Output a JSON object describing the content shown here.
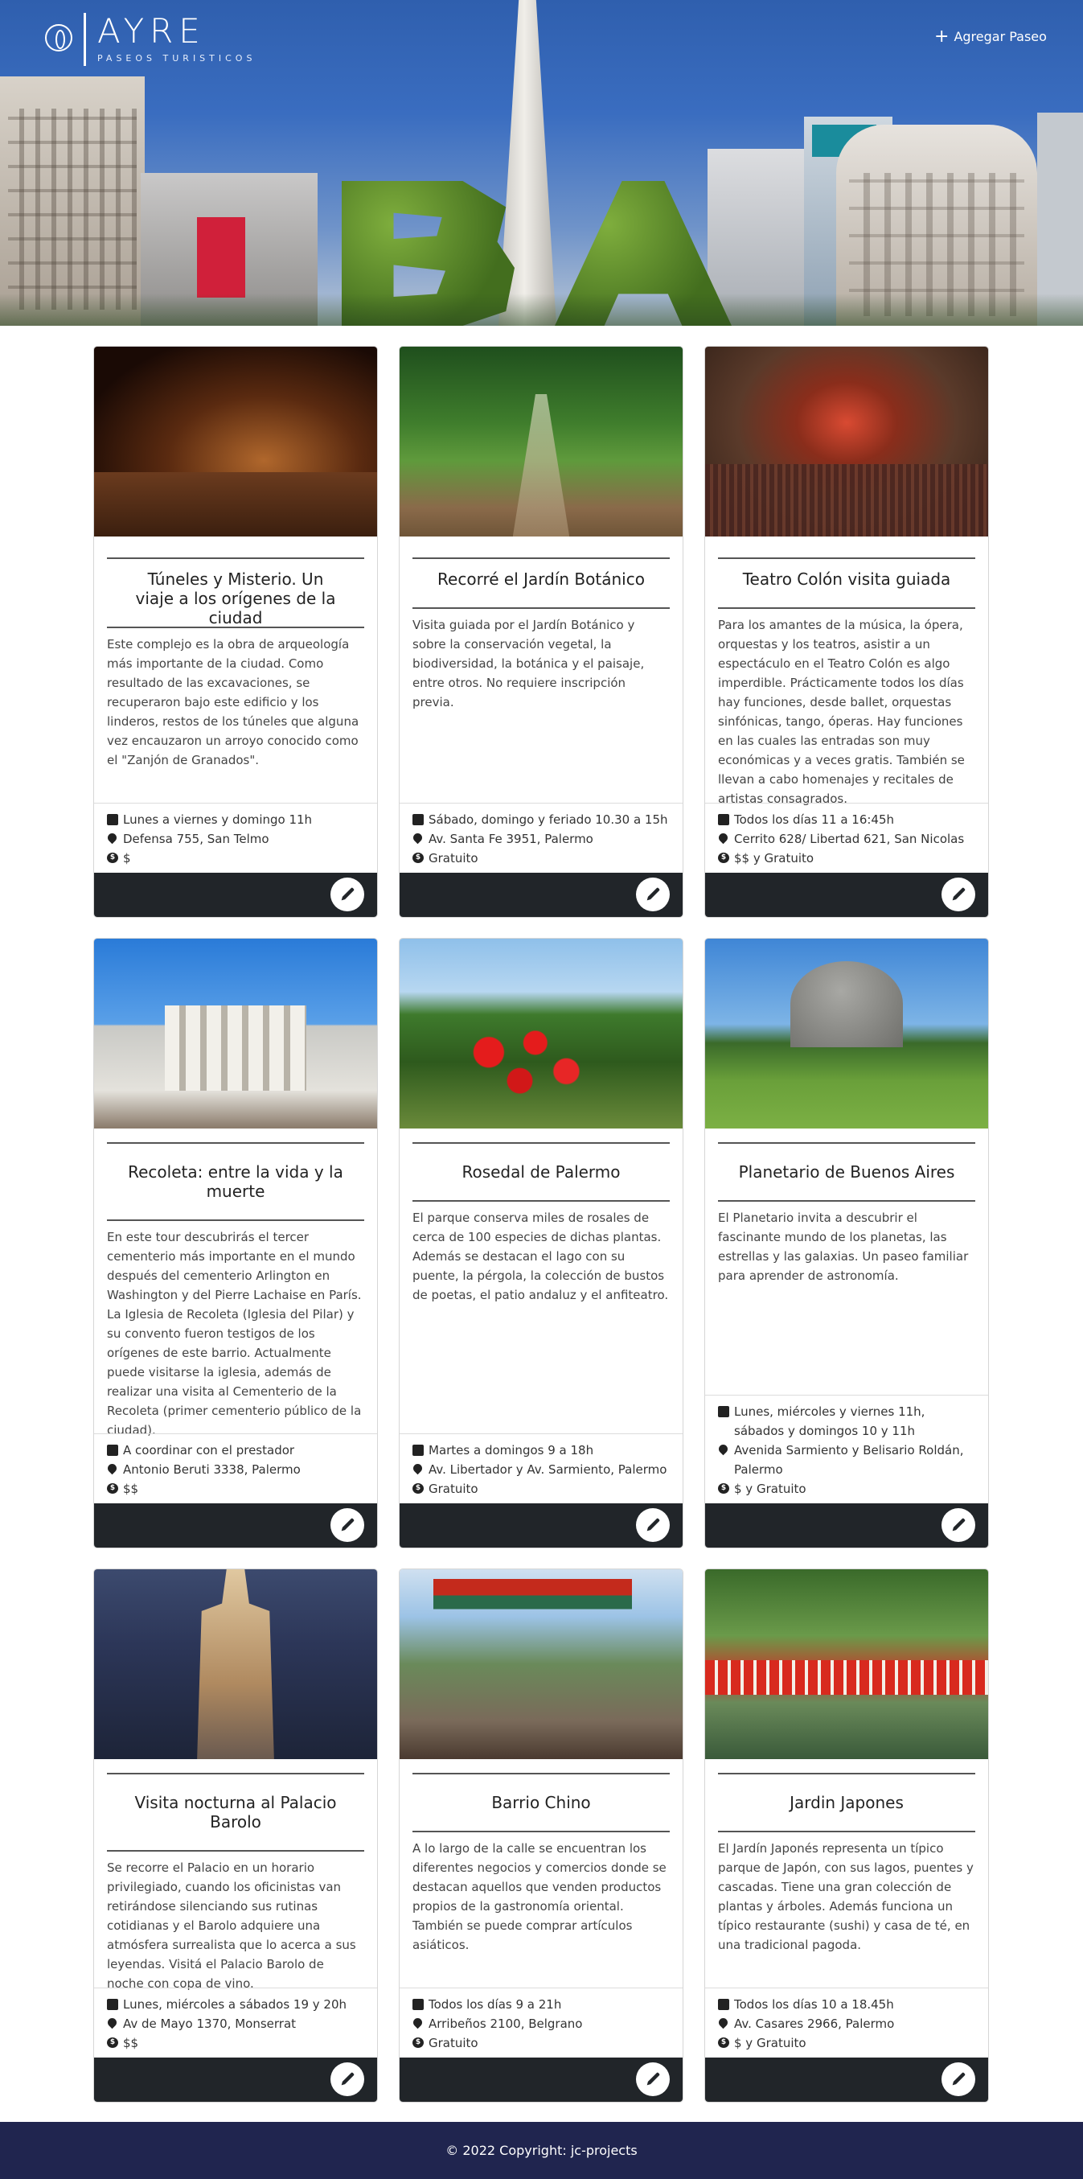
{
  "header": {
    "logo_name": "AYRE",
    "logo_tagline": "PASEOS TURISTICOS",
    "add_button_label": "Agregar Paseo"
  },
  "cards": [
    {
      "title": "Túneles y Misterio. Un viaje a los orígenes de la ciudad",
      "description": "Este complejo es la obra de arqueología más importante de la ciudad. Como resultado de las excavaciones, se recuperaron bajo este edificio y los linderos, restos de los túneles que alguna vez encauzaron un arroyo conocido como el \"Zanjón de Granados\".",
      "schedule": "Lunes a viernes y domingo 11h",
      "address": "Defensa 755, San Telmo",
      "price": "$"
    },
    {
      "title": "Recorré el Jardín Botánico",
      "description": "Visita guiada por el Jardín Botánico y sobre la conservación vegetal, la biodiversidad, la botánica y el paisaje, entre otros. No requiere inscripción previa.",
      "schedule": "Sábado, domingo y feriado 10.30 a 15h",
      "address": "Av. Santa Fe 3951, Palermo",
      "price": "Gratuito"
    },
    {
      "title": "Teatro Colón visita guiada",
      "description": "Para los amantes de la música, la ópera, orquestas y los teatros, asistir a un espectáculo en el Teatro Colón es algo imperdible. Prácticamente todos los días hay funciones, desde ballet, orquestas sinfónicas, tango, óperas. Hay funciones en las cuales las entradas son muy económicas y a veces gratis. También se llevan a cabo homenajes y recitales de artistas consagrados.",
      "schedule": "Todos los días 11 a 16:45h",
      "address": "Cerrito 628/ Libertad 621, San Nicolas",
      "price": "$$ y Gratuito"
    },
    {
      "title": "Recoleta: entre la vida y la muerte",
      "description": "En este tour descubrirás el tercer cementerio más importante en el mundo después del cementerio Arlington en Washington y del Pierre Lachaise en París. La Iglesia de Recoleta (Iglesia del Pilar) y su convento fueron testigos de los orígenes de este barrio. Actualmente puede visitarse la iglesia, además de realizar una visita al Cementerio de la Recoleta (primer cementerio público de la ciudad).",
      "schedule": "A coordinar con el prestador",
      "address": "Antonio Beruti 3338, Palermo",
      "price": "$$"
    },
    {
      "title": "Rosedal de Palermo",
      "description": "El parque conserva miles de rosales de cerca de 100 especies de dichas plantas. Además se destacan el lago con su puente, la pérgola, la colección de bustos de poetas, el patio andaluz y el anfiteatro.",
      "schedule": "Martes a domingos 9 a 18h",
      "address": "Av. Libertador y Av. Sarmiento, Palermo",
      "price": "Gratuito"
    },
    {
      "title": "Planetario de Buenos Aires",
      "description": "El Planetario invita a descubrir el fascinante mundo de los planetas, las estrellas y las galaxias. Un paseo familiar para aprender de astronomía.",
      "schedule": "Lunes, miércoles y viernes 11h, sábados y domingos 10 y 11h",
      "address": "Avenida Sarmiento y Belisario Roldán, Palermo",
      "price": "$ y Gratuito"
    },
    {
      "title": "Visita nocturna al Palacio Barolo",
      "description": "Se recorre el Palacio en un horario privilegiado, cuando los oficinistas van retirándose silenciando sus rutinas cotidianas y el Barolo adquiere una atmósfera surrealista que lo acerca a sus leyendas. Visitá el Palacio Barolo de noche con copa de vino.",
      "schedule": "Lunes, miércoles a sábados 19 y 20h",
      "address": "Av de Mayo 1370, Monserrat",
      "price": "$$"
    },
    {
      "title": "Barrio Chino",
      "description": "A lo largo de la calle se encuentran los diferentes negocios y comercios donde se destacan aquellos que venden productos propios de la gastronomía oriental. También se puede comprar artículos asiáticos.",
      "schedule": "Todos los días 9 a 21h",
      "address": "Arribeños 2100, Belgrano",
      "price": "Gratuito"
    },
    {
      "title": "Jardin Japones",
      "description": "El Jardín Japonés representa un típico parque de Japón, con sus lagos, puentes y cascadas. Tiene una gran colección de plantas y árboles. Además funciona un típico restaurante (sushi) y casa de té, en una tradicional pagoda.",
      "schedule": "Todos los días 10 a 18.45h",
      "address": "Av. Casares 2966, Palermo",
      "price": "$ y Gratuito"
    }
  ],
  "footer": {
    "copyright": "© 2022 Copyright: jc-projects"
  }
}
